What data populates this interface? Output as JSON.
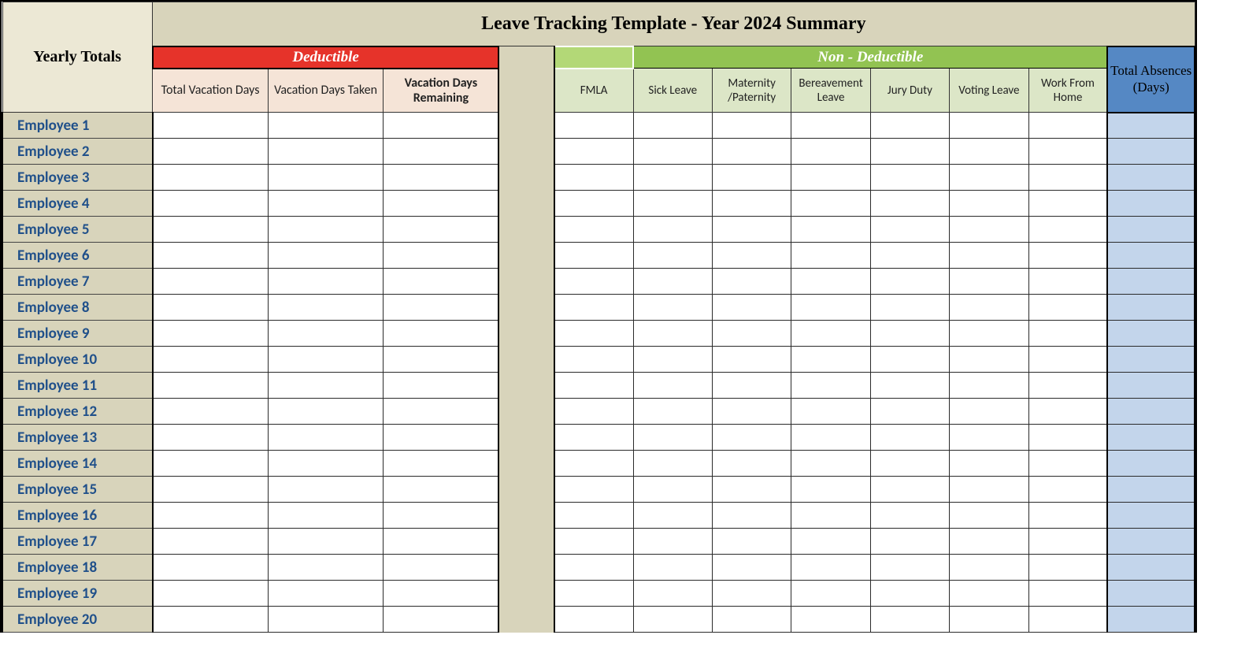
{
  "title": "Leave Tracking Template - Year 2024 Summary",
  "yearly_totals_label": "Yearly Totals",
  "deductible_label": "Deductible",
  "nondeductible_label": "Non - Deductible",
  "total_absences_label": "Total Absences (Days)",
  "deductible_cols": {
    "total_vac": "Total Vacation Days",
    "vac_taken": "Vacation Days Taken",
    "vac_remain": "Vacation Days Remaining"
  },
  "nondeductible_cols": {
    "fmla": "FMLA",
    "sick": "Sick Leave",
    "mat_pat": "Maternity /Paternity",
    "bereave": "Bereavement Leave",
    "jury": "Jury Duty",
    "voting": "Voting Leave",
    "wfh": "Work From Home"
  },
  "employees": [
    "Employee 1",
    "Employee 2",
    "Employee 3",
    "Employee 4",
    "Employee 5",
    "Employee 6",
    "Employee 7",
    "Employee 8",
    "Employee 9",
    "Employee 10",
    "Employee 11",
    "Employee 12",
    "Employee 13",
    "Employee 14",
    "Employee 15",
    "Employee 16",
    "Employee 17",
    "Employee 18",
    "Employee 19",
    "Employee 20"
  ]
}
